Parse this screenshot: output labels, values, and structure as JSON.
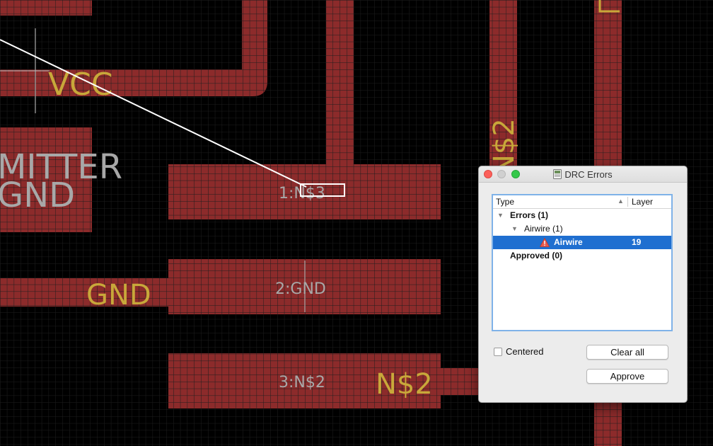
{
  "canvas": {
    "labels": {
      "vcc": "VCC",
      "mitter": "MITTER",
      "gnd_left": "GND",
      "gnd_trace": "GND",
      "n2_trace": "N$2",
      "n2_vertical": "N$2",
      "pad1": "1:N$3",
      "pad2": "2:GND",
      "pad3": "3:N$2"
    },
    "colors": {
      "background": "#000000",
      "grid": "#1c1c1c",
      "copper": "#8c2b2b",
      "airwire": "#ffffff",
      "yellow_text": "#c8a83a",
      "grey_text": "#a8a8a8"
    }
  },
  "drc_window": {
    "title": "DRC Errors",
    "columns": {
      "type": "Type",
      "layer": "Layer"
    },
    "tree": {
      "errors_label": "Errors (1)",
      "airwire_group_label": "Airwire (1)",
      "selected_item": {
        "label": "Airwire",
        "layer": "19"
      },
      "approved_label": "Approved (0)"
    },
    "centered_label": "Centered",
    "centered_checked": false,
    "clear_all_label": "Clear all",
    "approve_label": "Approve",
    "selection_color": "#1f6fd0"
  }
}
